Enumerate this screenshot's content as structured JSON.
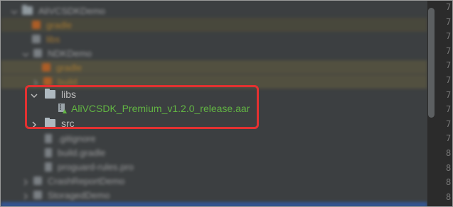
{
  "tree": {
    "root_label": "AliVCSDKDemo",
    "rows": [
      {
        "label": "gradle",
        "blurred": true
      },
      {
        "label": "libs",
        "blurred": true
      },
      {
        "label": "NDKDemo",
        "blurred": true
      },
      {
        "label": "gradle",
        "blurred": true
      },
      {
        "label": "build",
        "blurred": true
      },
      {
        "label": "libs",
        "blurred": false
      },
      {
        "label": "AliVCSDK_Premium_v1.2.0_release.aar",
        "blurred": false
      },
      {
        "label": "src",
        "blurred": false
      },
      {
        "label": ".gitignore",
        "blurred": true
      },
      {
        "label": "build.gradle",
        "blurred": true
      },
      {
        "label": "proguard-rules.pro",
        "blurred": true
      },
      {
        "label": "CrashReportDemo",
        "blurred": true
      },
      {
        "label": "StoragedDemo",
        "blurred": true
      }
    ]
  },
  "icons": {
    "folder": "folder-icon",
    "archive": "aar-archive-icon",
    "expanded": "chevron-down-icon",
    "collapsed": "chevron-right-icon"
  },
  "colors": {
    "panel_bg": "#3c3f41",
    "highlight": "#e33131",
    "green_text": "#62b543"
  },
  "gutter": {
    "line_numbers": [
      "7",
      "7",
      "7",
      "7",
      "7",
      "7",
      "7",
      "7",
      "7",
      "7",
      "8",
      "8",
      "8",
      "8"
    ]
  }
}
